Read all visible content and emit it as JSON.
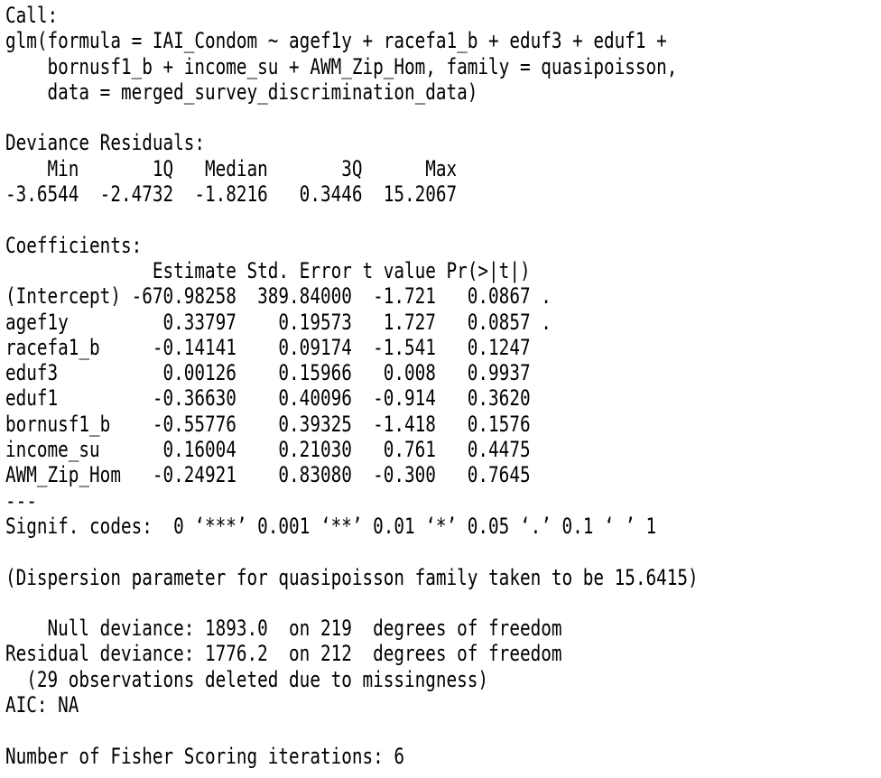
{
  "output": {
    "lines": [
      "Call:",
      "glm(formula = IAI_Condom ~ agef1y + racefa1_b + eduf3 + eduf1 +",
      "    bornusf1_b + income_su + AWM_Zip_Hom, family = quasipoisson,",
      "    data = merged_survey_discrimination_data)",
      "",
      "Deviance Residuals:",
      "    Min       1Q   Median       3Q      Max",
      "-3.6544  -2.4732  -1.8216   0.3446  15.2067",
      "",
      "Coefficients:",
      "              Estimate Std. Error t value Pr(>|t|)",
      "(Intercept) -670.98258  389.84000  -1.721   0.0867 .",
      "agef1y         0.33797    0.19573   1.727   0.0857 .",
      "racefa1_b     -0.14141    0.09174  -1.541   0.1247",
      "eduf3          0.00126    0.15966   0.008   0.9937",
      "eduf1         -0.36630    0.40096  -0.914   0.3620",
      "bornusf1_b    -0.55776    0.39325  -1.418   0.1576",
      "income_su      0.16004    0.21030   0.761   0.4475",
      "AWM_Zip_Hom   -0.24921    0.83080  -0.300   0.7645",
      "---",
      "Signif. codes:  0 ‘***’ 0.001 ‘**’ 0.01 ‘*’ 0.05 ‘.’ 0.1 ‘ ’ 1",
      "",
      "(Dispersion parameter for quasipoisson family taken to be 15.6415)",
      "",
      "    Null deviance: 1893.0  on 219  degrees of freedom",
      "Residual deviance: 1776.2  on 212  degrees of freedom",
      "  (29 observations deleted due to missingness)",
      "AIC: NA",
      "",
      "Number of Fisher Scoring iterations: 6"
    ]
  }
}
